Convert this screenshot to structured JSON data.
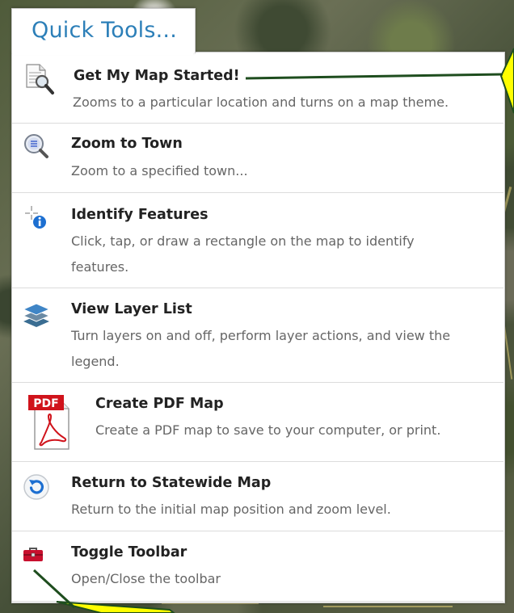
{
  "panel": {
    "tab_title": "Quick Tools..."
  },
  "tools": [
    {
      "id": "get-my-map-started",
      "title": "Get My Map Started!",
      "description": "Zooms to a particular location and turns on a map theme.",
      "icon": "magnifier-document-icon"
    },
    {
      "id": "zoom-to-town",
      "title": "Zoom to Town",
      "description": "Zoom to a specified town...",
      "icon": "zoom-list-icon"
    },
    {
      "id": "identify-features",
      "title": "Identify Features",
      "description": "Click, tap, or draw a rectangle on the map to identify features.",
      "icon": "identify-info-icon"
    },
    {
      "id": "view-layer-list",
      "title": "View Layer List",
      "description": "Turn layers on and off, perform layer actions, and view the legend.",
      "icon": "layers-icon"
    },
    {
      "id": "create-pdf-map",
      "title": "Create PDF Map",
      "description": "Create a PDF map to save to your computer, or print.",
      "icon": "pdf-icon",
      "icon_label": "PDF"
    },
    {
      "id": "return-to-statewide-map",
      "title": "Return to Statewide Map",
      "description": "Return to the initial map position and zoom level.",
      "icon": "refresh-icon"
    },
    {
      "id": "toggle-toolbar",
      "title": "Toggle Toolbar",
      "description": "Open/Close the toolbar",
      "icon": "toolbox-icon"
    }
  ],
  "colors": {
    "tab_title": "#2c7fb8",
    "title_text": "#222222",
    "description_text": "#666666",
    "divider": "#dcdcdc",
    "callout_fill": "#ffff00",
    "callout_line": "#1e4d1e",
    "pdf_red": "#d0131b",
    "toolbox_red": "#c8102e"
  }
}
